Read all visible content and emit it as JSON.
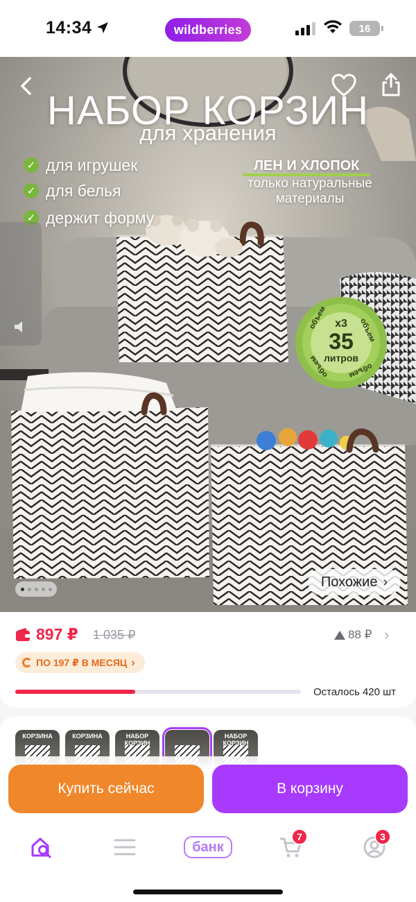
{
  "status_bar": {
    "time": "14:34",
    "brand": "wildberries",
    "battery": "16"
  },
  "hero": {
    "title": "НАБОР КОРЗИН",
    "subtitle": "для хранения",
    "features": [
      "для игрушек",
      "для белья",
      "держит форму"
    ],
    "material_title": "ЛЕН И ХЛОПОК",
    "material_sub_1": "только натуральные",
    "material_sub_2": "материалы",
    "badge_multiplier": "x3",
    "badge_volume": "35",
    "badge_unit": "литров",
    "badge_ring_word": "объем",
    "slides_total": 5,
    "slide_active": 1,
    "similar_label": "Похожие"
  },
  "price": {
    "current": "897 ₽",
    "old": "1 035 ₽",
    "points": "88 ₽",
    "installment": "ПО 197 ₽ В МЕСЯЦ",
    "stock_fraction": 0.42,
    "stock_text": "Осталось 420 шт"
  },
  "thumbnails": [
    {
      "label": "КОРЗИНА",
      "selected": false
    },
    {
      "label": "КОРЗИНА",
      "selected": false
    },
    {
      "label": "НАБОР КОРЗИН",
      "selected": false
    },
    {
      "label": "",
      "selected": true
    },
    {
      "label": "НАБОР КОРЗИН",
      "selected": false
    }
  ],
  "actions": {
    "buy_now": "Купить сейчас",
    "add_to_cart": "В корзину"
  },
  "tabbar": {
    "bank_label": "банк",
    "cart_count": "7",
    "profile_count": "3"
  },
  "colors": {
    "brand_purple": "#a73afd",
    "buy_orange": "#f0872b",
    "price_red": "#f0264a",
    "badge_green": "#8dbf4a"
  }
}
